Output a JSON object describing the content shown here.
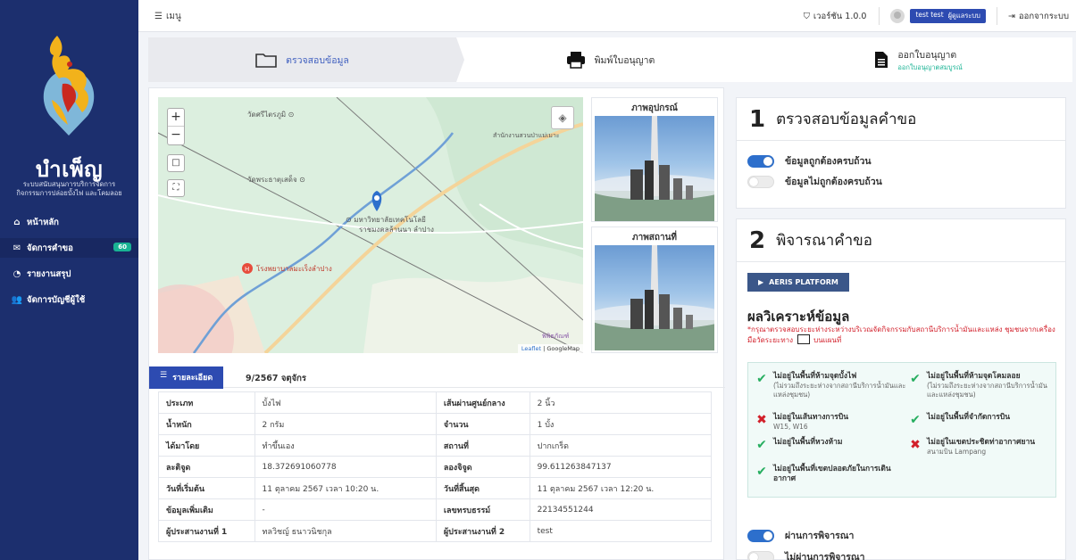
{
  "sidebar": {
    "brand": "บำเพ็ญ",
    "subtitle_line1": "ระบบสนับสนุนการบริการจัดการ",
    "subtitle_line2": "กิจกรรมการปล่อยบั้งไฟ และโคมลอย",
    "items": [
      {
        "label": "หน้าหลัก",
        "icon": "home-icon"
      },
      {
        "label": "จัดการคำขอ",
        "icon": "inbox-icon",
        "badge": "60"
      },
      {
        "label": "รายงานสรุป",
        "icon": "report-icon"
      },
      {
        "label": "จัดการบัญชีผู้ใช้",
        "icon": "users-icon"
      }
    ]
  },
  "topbar": {
    "menu_label": "เมนู",
    "version": "เวอร์ชัน 1.0.0",
    "user_name": "test test",
    "user_role": "ผู้ดูแลระบบ",
    "logout": "ออกจากระบบ"
  },
  "steps": [
    {
      "label": "ตรวจสอบข้อมูล",
      "icon": "folder-icon"
    },
    {
      "label": "พิมพ์ใบอนุญาต",
      "icon": "printer-icon"
    },
    {
      "label": "ออกใบอนุญาต",
      "sub": "ออกใบอนุญาตสมบูรณ์",
      "icon": "document-icon"
    }
  ],
  "map": {
    "attribution_leaflet": "Leaflet",
    "attribution_google": "GoogleMap"
  },
  "photos": {
    "equipment_title": "ภาพอุปกรณ์",
    "place_title": "ภาพสถานที่"
  },
  "details": {
    "tab_label": "รายละเอียด",
    "code": "9/2567 จตุจักร",
    "rows": [
      {
        "k1": "ประเภท",
        "v1": "บั้งไฟ",
        "k2": "เส้นผ่านศูนย์กลาง",
        "v2": "2 นิ้ว"
      },
      {
        "k1": "น้ำหนัก",
        "v1": "2 กรัม",
        "k2": "จำนวน",
        "v2": "1 บั้ง"
      },
      {
        "k1": "ได้มาโดย",
        "v1": "ทำขึ้นเอง",
        "k2": "สถานที่",
        "v2": "ปากเกร็ด"
      },
      {
        "k1": "ละติจูด",
        "v1": "18.372691060778",
        "k2": "ลองจิจูด",
        "v2": "99.611263847137"
      },
      {
        "k1": "วันที่เริ่มต้น",
        "v1": "11 ตุลาคม 2567 เวลา 10:20 น.",
        "k2": "วันที่สิ้นสุด",
        "v2": "11 ตุลาคม 2567 เวลา 12:20 น."
      },
      {
        "k1": "ข้อมูลเพิ่มเติม",
        "v1": "-",
        "k2": "เลขทรบธรรม์",
        "v2": "22134551244"
      },
      {
        "k1": "ผู้ประสานงานที่ 1",
        "v1": "ทลวิชญ์ ธนาวนิชกุล",
        "k2": "ผู้ประสานงานที่ 2",
        "v2": "test"
      }
    ]
  },
  "panel1": {
    "num": "1",
    "title": "ตรวจสอบข้อมูลคำขอ",
    "opt_ok": "ข้อมูลถูกต้องครบถ้วน",
    "opt_bad": "ข้อมูลไม่ถูกต้องครบถ้วน"
  },
  "panel2": {
    "num": "2",
    "title": "พิจารณาคำขอ",
    "aeris": "AERIS PLATFORM",
    "analysis_title": "ผลวิเคราะห์ข้อมูล",
    "analysis_note_a": "*กรุณาตรวจสอบระยะห่างระหว่างบริเวณจัดกิจกรรมกับสถานีบริการน้ำมันและแหล่ง",
    "analysis_note_b": "ชุมชนจากเครื่องมือวัดระยะทาง",
    "analysis_note_c": "บนแผนที่",
    "checks": [
      {
        "status": "ok",
        "title": "ไม่อยู่ในพื้นที่ห้ามจุดบั้งไฟ",
        "sub": "(ไม่รวมถึงระยะห่างจากสถานีบริการน้ำมันและแหล่งชุมชน)"
      },
      {
        "status": "ok",
        "title": "ไม่อยู่ในพื้นที่ห้ามจุดโคมลอย",
        "sub": "(ไม่รวมถึงระยะห่างจากสถานีบริการน้ำมันและแหล่งชุมชน)"
      },
      {
        "status": "bad",
        "title": "ไม่อยู่ในเส้นทางการบิน",
        "sub": "W15, W16"
      },
      {
        "status": "ok",
        "title": "ไม่อยู่ในพื้นที่จำกัดการบิน",
        "sub": ""
      },
      {
        "status": "ok",
        "title": "ไม่อยู่ในพื้นที่หวงห้าม",
        "sub": ""
      },
      {
        "status": "bad",
        "title": "ไม่อยู่ในเขตประชิดท่าอากาศยาน",
        "sub": "สนามบิน Lampang"
      },
      {
        "status": "ok",
        "title": "ไม่อยู่ในพื้นที่เขตปลอดภัยในการเดินอากาศ",
        "sub": ""
      }
    ],
    "pass": "ผ่านการพิจารณา",
    "fail": "ไม่ผ่านการพิจารณา"
  },
  "colors": {
    "sidebar": "#1c2f6e",
    "accent": "#2d4bb1",
    "toggle_on": "#2d6fcc",
    "success": "#27ae60",
    "danger": "#d21f2a"
  }
}
